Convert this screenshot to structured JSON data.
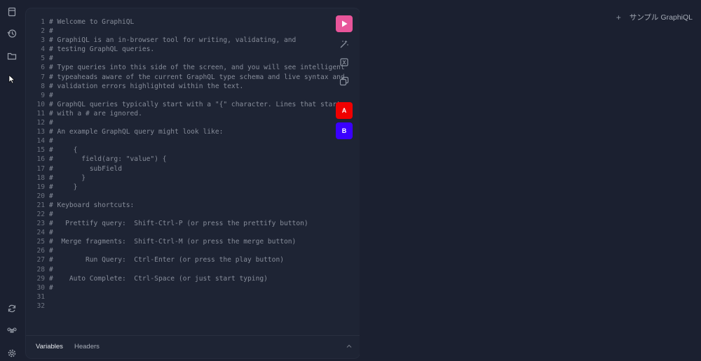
{
  "sidebar": {
    "icons": [
      "docs-icon",
      "history-icon",
      "folder-icon",
      "cursor-icon",
      "refresh-icon",
      "command-icon",
      "settings-icon"
    ]
  },
  "editor": {
    "lines": [
      {
        "n": "1",
        "t": "# Welcome to GraphiQL"
      },
      {
        "n": "2",
        "t": "#"
      },
      {
        "n": "3",
        "t": "# GraphiQL is an in-browser tool for writing, validating, and"
      },
      {
        "n": "4",
        "t": "# testing GraphQL queries."
      },
      {
        "n": "5",
        "t": "#"
      },
      {
        "n": "6",
        "t": "# Type queries into this side of the screen, and you will see intelligent"
      },
      {
        "n": "7",
        "t": "# typeaheads aware of the current GraphQL type schema and live syntax and"
      },
      {
        "n": "8",
        "t": "# validation errors highlighted within the text."
      },
      {
        "n": "9",
        "t": "#"
      },
      {
        "n": "10",
        "t": "# GraphQL queries typically start with a \"{\" character. Lines that start"
      },
      {
        "n": "11",
        "t": "# with a # are ignored."
      },
      {
        "n": "12",
        "t": "#"
      },
      {
        "n": "13",
        "t": "# An example GraphQL query might look like:"
      },
      {
        "n": "14",
        "t": "#"
      },
      {
        "n": "15",
        "t": "#     {"
      },
      {
        "n": "16",
        "t": "#       field(arg: \"value\") {"
      },
      {
        "n": "17",
        "t": "#         subField"
      },
      {
        "n": "18",
        "t": "#       }"
      },
      {
        "n": "19",
        "t": "#     }"
      },
      {
        "n": "20",
        "t": "#"
      },
      {
        "n": "21",
        "t": "# Keyboard shortcuts:"
      },
      {
        "n": "22",
        "t": "#"
      },
      {
        "n": "23",
        "t": "#   Prettify query:  Shift-Ctrl-P (or press the prettify button)"
      },
      {
        "n": "24",
        "t": "#"
      },
      {
        "n": "25",
        "t": "#  Merge fragments:  Shift-Ctrl-M (or press the merge button)"
      },
      {
        "n": "26",
        "t": "#"
      },
      {
        "n": "27",
        "t": "#        Run Query:  Ctrl-Enter (or press the play button)"
      },
      {
        "n": "28",
        "t": "#"
      },
      {
        "n": "29",
        "t": "#    Auto Complete:  Ctrl-Space (or just start typing)"
      },
      {
        "n": "30",
        "t": "#"
      },
      {
        "n": "31",
        "t": ""
      },
      {
        "n": "32",
        "t": ""
      }
    ]
  },
  "toolbar": {
    "run_icon": "play-icon",
    "prettify_icon": "prettify-icon",
    "merge_icon": "merge-icon",
    "copy_icon": "copy-icon",
    "btn_a": "A",
    "btn_b": "B",
    "run_color": "#e535ab",
    "a_color": "#ff0000",
    "b_color": "#3300ff"
  },
  "bottom": {
    "variables_tab": "Variables",
    "headers_tab": "Headers"
  },
  "header": {
    "add": "+",
    "tab_title": "サンプル GraphiQL"
  }
}
